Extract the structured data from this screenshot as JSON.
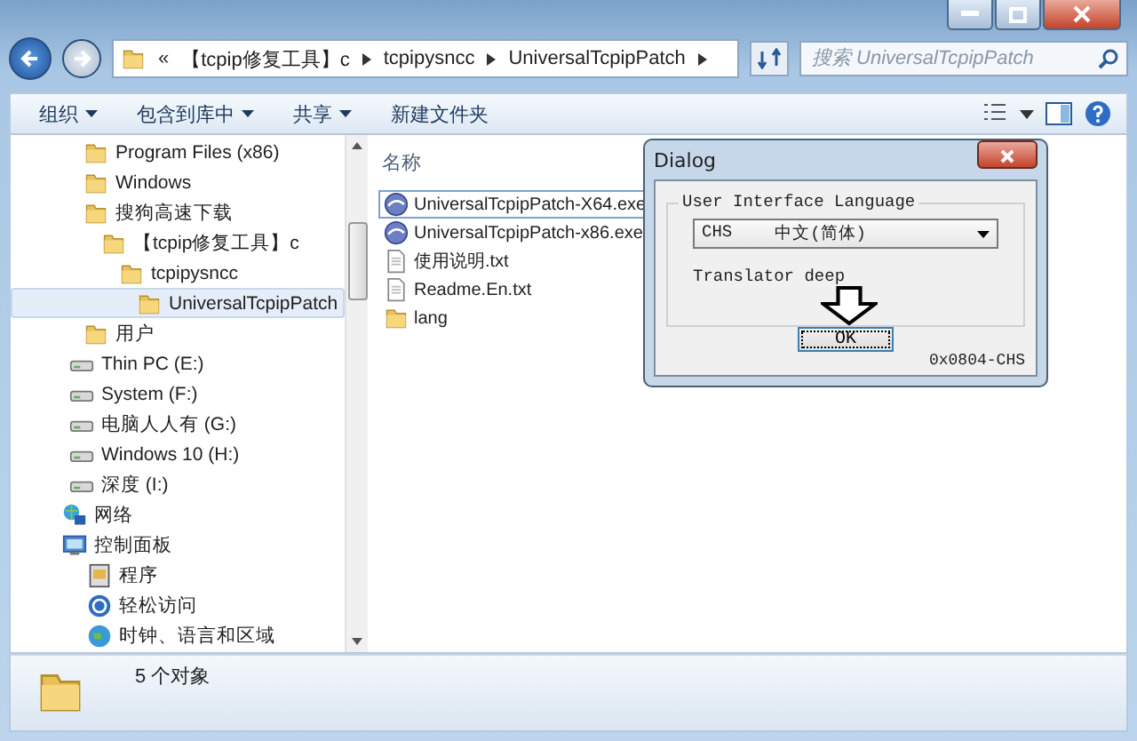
{
  "address_bar": {
    "overflow": "«",
    "crumbs": [
      "【tcpip修复工具】c",
      "tcpipysncc",
      "UniversalTcpipPatch"
    ]
  },
  "search": {
    "placeholder": "搜索 UniversalTcpipPatch"
  },
  "toolbar": {
    "items": [
      "组织",
      "包含到库中",
      "共享",
      "新建文件夹"
    ],
    "dropdown": [
      true,
      true,
      true,
      false
    ]
  },
  "sidebar": {
    "items": [
      {
        "label": "Program Files (x86)",
        "kind": "folder",
        "selected": false
      },
      {
        "label": "Windows",
        "kind": "folder",
        "selected": false
      },
      {
        "label": "搜狗高速下载",
        "kind": "folder",
        "selected": false,
        "children": [
          {
            "label": "【tcpip修复工具】c",
            "kind": "folder",
            "selected": false,
            "children": [
              {
                "label": "tcpipysncc",
                "kind": "folder",
                "selected": false,
                "children": [
                  {
                    "label": "UniversalTcpipPatch",
                    "kind": "folder",
                    "selected": true
                  }
                ]
              }
            ]
          }
        ]
      },
      {
        "label": "用户",
        "kind": "folder",
        "selected": false
      },
      {
        "label": "Thin PC (E:)",
        "kind": "drive",
        "selected": false
      },
      {
        "label": "System (F:)",
        "kind": "drive",
        "selected": false
      },
      {
        "label": "电脑人人有 (G:)",
        "kind": "drive",
        "selected": false
      },
      {
        "label": "Windows 10 (H:)",
        "kind": "drive",
        "selected": false
      },
      {
        "label": "深度 (I:)",
        "kind": "drive",
        "selected": false
      },
      {
        "label": "网络",
        "kind": "network",
        "selected": false
      },
      {
        "label": "控制面板",
        "kind": "control",
        "selected": false,
        "children": [
          {
            "label": "程序",
            "kind": "program",
            "selected": false
          },
          {
            "label": "轻松访问",
            "kind": "access",
            "selected": false
          },
          {
            "label": "时钟、语言和区域",
            "kind": "globe",
            "selected": false
          }
        ]
      }
    ]
  },
  "files": {
    "column": "名称",
    "items": [
      {
        "name": "UniversalTcpipPatch-X64.exe",
        "kind": "exe",
        "selected": true
      },
      {
        "name": "UniversalTcpipPatch-x86.exe",
        "kind": "exe",
        "selected": false
      },
      {
        "name": "使用说明.txt",
        "kind": "txt",
        "selected": false
      },
      {
        "name": "Readme.En.txt",
        "kind": "txt",
        "selected": false
      },
      {
        "name": "lang",
        "kind": "folder",
        "selected": false
      }
    ]
  },
  "status_bar": {
    "count": "5 个对象"
  },
  "dialog": {
    "title": "Dialog",
    "group": "User Interface Language",
    "language_code": "CHS",
    "language_name": "中文(简体)",
    "translator": "Translator deep",
    "ok": "OK",
    "footer": "0x0804-CHS"
  }
}
